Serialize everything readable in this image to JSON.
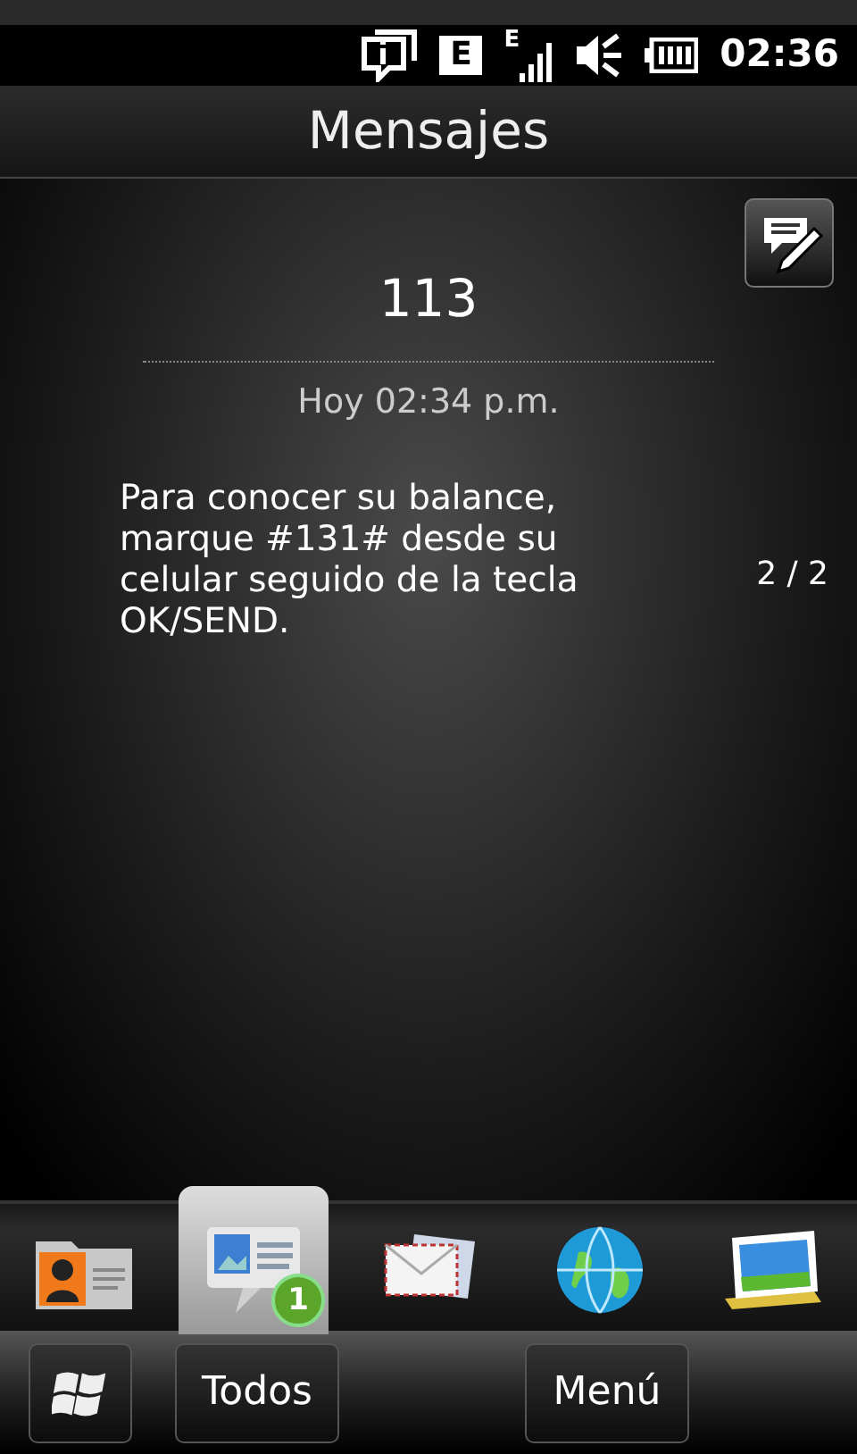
{
  "status_bar": {
    "data_mode": "E",
    "signal_mode": "E",
    "time": "02:36"
  },
  "title": "Mensajes",
  "message": {
    "sender": "113",
    "timestamp": "Hoy 02:34 p.m.",
    "body": "Para conocer su balance, marque #131# desde su celular seguido de la tecla OK/SEND.",
    "counter": "2 / 2"
  },
  "tabs": [
    {
      "kind": "contacts",
      "selected": false
    },
    {
      "kind": "messages",
      "selected": true,
      "badge": "1"
    },
    {
      "kind": "mail",
      "selected": false
    },
    {
      "kind": "internet",
      "selected": false
    },
    {
      "kind": "photos",
      "selected": false
    }
  ],
  "softkeys": {
    "left": "Todos",
    "right": "Menú"
  }
}
